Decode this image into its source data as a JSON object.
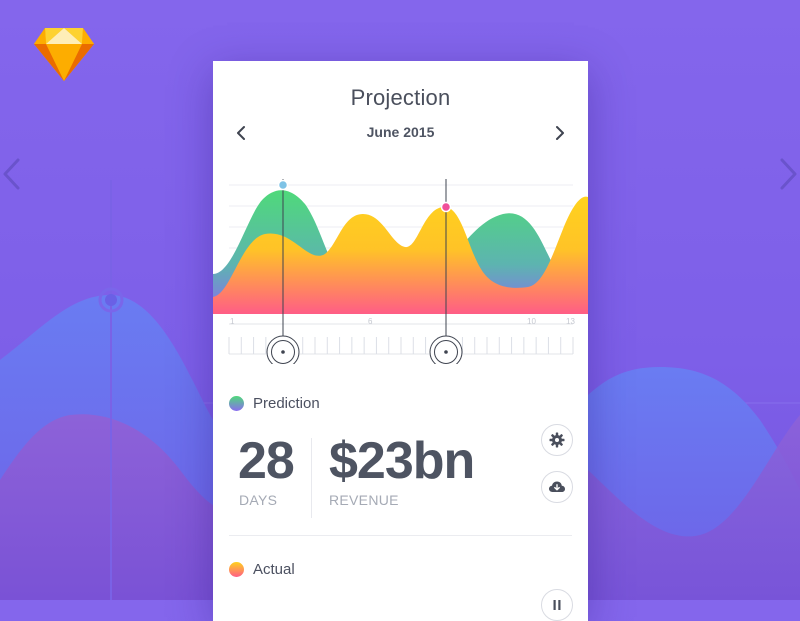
{
  "card": {
    "title": "Projection",
    "month": "June 2015"
  },
  "ruler_labels": [
    "1",
    "6",
    "10",
    "13"
  ],
  "series": [
    {
      "name": "Prediction",
      "gradient": [
        "#4fd97a",
        "#8a6cf0"
      ]
    },
    {
      "name": "Actual",
      "gradient": [
        "#ffd21e",
        "#ff5d86"
      ]
    }
  ],
  "stats": {
    "days_value": "28",
    "days_label": "DAYS",
    "revenue_value": "$23bn",
    "revenue_label": "REVENUE"
  },
  "icons": {
    "logo": "sketch-diamond-icon",
    "prev": "chevron-left-icon",
    "next": "chevron-right-icon",
    "settings": "gear-icon",
    "download": "cloud-download-icon"
  },
  "colors": {
    "background": "#8466ec",
    "text_dark": "#4e5462",
    "text_muted": "#a5aab5",
    "marker_prediction": "#7ec3e6",
    "marker_actual": "#f0509a"
  }
}
